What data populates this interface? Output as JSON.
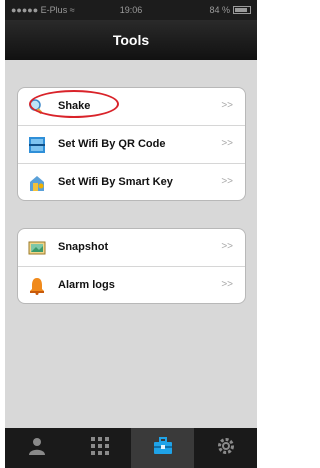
{
  "status_bar": {
    "carrier": "●●●●● E-Plus ≈",
    "time": "19:06",
    "battery": "84 %"
  },
  "header": {
    "title": "Tools"
  },
  "groups": [
    {
      "items": [
        {
          "label": "Shake",
          "icon": "magnifier-icon"
        },
        {
          "label": "Set Wifi By QR Code",
          "icon": "qr-scan-icon"
        },
        {
          "label": "Set Wifi By Smart Key",
          "icon": "smart-key-icon"
        }
      ]
    },
    {
      "items": [
        {
          "label": "Snapshot",
          "icon": "picture-icon"
        },
        {
          "label": "Alarm logs",
          "icon": "bell-icon"
        }
      ]
    }
  ],
  "chevron": ">>",
  "tabs": [
    {
      "name": "contacts",
      "icon": "person-icon",
      "active": false
    },
    {
      "name": "grid",
      "icon": "grid-icon",
      "active": false
    },
    {
      "name": "tools",
      "icon": "toolbox-icon",
      "active": true
    },
    {
      "name": "settings",
      "icon": "gear-icon",
      "active": false
    }
  ],
  "colors": {
    "accent": "#1fa3e8",
    "highlight": "#d9232a"
  }
}
